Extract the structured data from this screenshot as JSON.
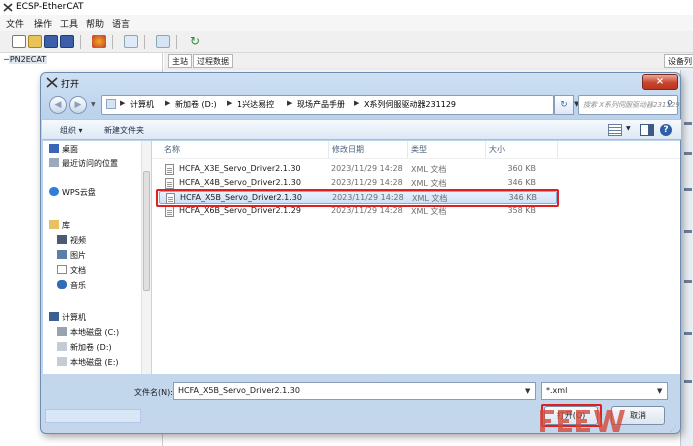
{
  "app": {
    "title": "ECSP-EtherCAT",
    "menu": [
      "文件",
      "操作",
      "工具",
      "帮助",
      "语言"
    ],
    "tree_node": "PN2ECAT",
    "tabs": [
      "主站",
      "过程数据"
    ],
    "right_tab": "设备列"
  },
  "dialog": {
    "title": "打开",
    "close_glyph": "×",
    "breadcrumb": [
      "计算机",
      "新加卷 (D:)",
      "1兴达易控",
      "现场产品手册",
      "X系列伺服驱动器231129"
    ],
    "search_placeholder": "搜索 X系列伺服驱动器231129",
    "organize_label": "组织 ▾",
    "new_folder_label": "新建文件夹",
    "nav": {
      "favorites": [
        "桌面",
        "最近访问的位置"
      ],
      "cloud": "WPS云盘",
      "library_title": "库",
      "libraries": [
        "视频",
        "图片",
        "文档",
        "音乐"
      ],
      "computer_title": "计算机",
      "drives": [
        "本地磁盘 (C:)",
        "新加卷 (D:)",
        "本地磁盘 (E:)"
      ]
    },
    "columns": {
      "name": "名称",
      "date": "修改日期",
      "type": "类型",
      "size": "大小"
    },
    "files": [
      {
        "name": "HCFA_X3E_Servo_Driver2.1.30",
        "date": "2023/11/29 14:28",
        "type": "XML 文档",
        "size": "360 KB"
      },
      {
        "name": "HCFA_X4B_Servo_Driver2.1.30",
        "date": "2023/11/29 14:28",
        "type": "XML 文档",
        "size": "346 KB"
      },
      {
        "name": "HCFA_X5B_Servo_Driver2.1.30",
        "date": "2023/11/29 14:28",
        "type": "XML 文档",
        "size": "346 KB"
      },
      {
        "name": "HCFA_X6B_Servo_Driver2.1.29",
        "date": "2023/11/29 14:28",
        "type": "XML 文档",
        "size": "358 KB"
      }
    ],
    "selected_index": 2,
    "filename_label": "文件名(N):",
    "filename_value": "HCFA_X5B_Servo_Driver2.1.30",
    "filetype_value": "*.xml",
    "open_label": "打开(O)",
    "cancel_label": "取消"
  },
  "colors": {
    "highlight_red": "#e02020",
    "selection_blue": "#cfe2f8",
    "close_red": "#c9452d"
  },
  "icons": [
    "app-logo-icon",
    "back-icon",
    "forward-icon",
    "refresh-icon",
    "search-icon",
    "xml-file-icon",
    "desktop-icon",
    "recent-icon",
    "cloud-icon",
    "library-icon",
    "video-icon",
    "picture-icon",
    "document-icon",
    "music-icon",
    "computer-icon",
    "drive-icon"
  ]
}
